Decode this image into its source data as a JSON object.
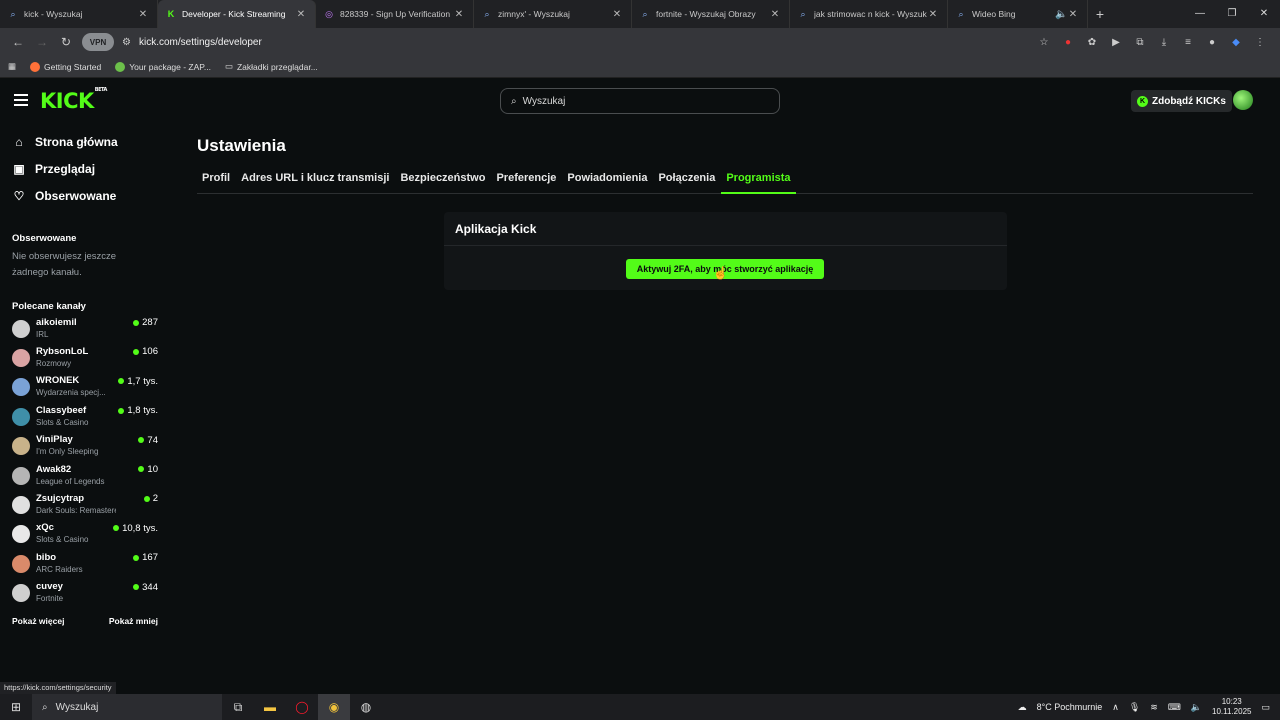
{
  "browser": {
    "tabs": [
      {
        "title": "kick - Wyszukaj",
        "icon": "search-icon",
        "active": false
      },
      {
        "title": "Developer - Kick Streaming",
        "icon": "kick-icon",
        "active": true
      },
      {
        "title": "828339 - Sign Up Verification C",
        "icon": "app-icon",
        "active": false
      },
      {
        "title": "zimnyx' - Wyszukaj",
        "icon": "search-icon",
        "active": false
      },
      {
        "title": "fortnite - Wyszukaj Obrazy",
        "icon": "search-icon",
        "active": false
      },
      {
        "title": "jak strimowac n kick - Wyszukaj",
        "icon": "search-icon",
        "active": false
      },
      {
        "title": "Wideo Bing",
        "icon": "search-icon",
        "active": false
      }
    ],
    "url": "kick.com/settings/developer",
    "vpn_label": "VPN",
    "bookmarks": [
      "Getting Started",
      "Your package - ZAP...",
      "Zakładki przeglądar..."
    ],
    "status_url": "https://kick.com/settings/security"
  },
  "header": {
    "logo": "KICK",
    "logo_sup": "BETA",
    "search_placeholder": "Wyszukaj",
    "kicks_button": "Zdobądź KICKs"
  },
  "sidebar": {
    "nav": [
      {
        "label": "Strona główna",
        "icon": "home-icon"
      },
      {
        "label": "Przeglądaj",
        "icon": "browse-icon"
      },
      {
        "label": "Obserwowane",
        "icon": "heart-icon"
      }
    ],
    "following_title": "Obserwowane",
    "following_empty": "Nie obserwujesz jeszcze żadnego kanału.",
    "recommended_title": "Polecane kanały",
    "channels": [
      {
        "name": "aikoiemil",
        "category": "IRL",
        "viewers": "287",
        "color": "#cfcfcf"
      },
      {
        "name": "RybsonLoL",
        "category": "Rozmowy",
        "viewers": "106",
        "color": "#d9a3a3"
      },
      {
        "name": "WRONEK",
        "category": "Wydarzenia specj...",
        "viewers": "1,7 tys.",
        "color": "#7aa2d6"
      },
      {
        "name": "Classybeef",
        "category": "Slots & Casino",
        "viewers": "1,8 tys.",
        "color": "#3f8fa8"
      },
      {
        "name": "ViniPlay",
        "category": "I'm Only Sleeping",
        "viewers": "74",
        "color": "#c8b28a"
      },
      {
        "name": "Awak82",
        "category": "League of Legends",
        "viewers": "10",
        "color": "#b5b5b5"
      },
      {
        "name": "Zsujcytrap",
        "category": "Dark Souls: Remastered",
        "viewers": "2",
        "color": "#e0e0e0"
      },
      {
        "name": "xQc",
        "category": "Slots & Casino",
        "viewers": "10,8 tys.",
        "color": "#e8e8e8"
      },
      {
        "name": "bibo",
        "category": "ARC Raiders",
        "viewers": "167",
        "color": "#d98a6a"
      },
      {
        "name": "cuvey",
        "category": "Fortnite",
        "viewers": "344",
        "color": "#cfcfcf"
      }
    ],
    "show_more": "Pokaż więcej",
    "show_less": "Pokaż mniej"
  },
  "main": {
    "title": "Ustawienia",
    "tabs": [
      "Profil",
      "Adres URL i klucz transmisji",
      "Bezpieczeństwo",
      "Preferencje",
      "Powiadomienia",
      "Połączenia",
      "Programista"
    ],
    "active_tab": "Programista",
    "card_title": "Aplikacja Kick",
    "card_button": "Aktywuj 2FA, aby móc stworzyć aplikację"
  },
  "taskbar": {
    "search_placeholder": "Wyszukaj",
    "weather": "8°C  Pochmurnie",
    "time": "10:23",
    "date": "10.11.2025"
  },
  "colors": {
    "accent": "#53fc18",
    "background": "#0b0e0f"
  }
}
